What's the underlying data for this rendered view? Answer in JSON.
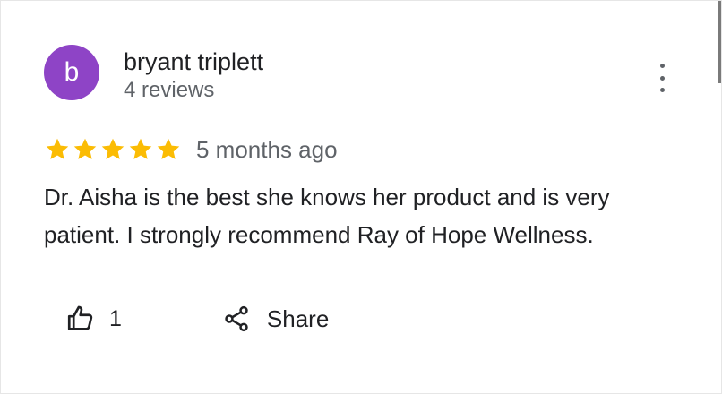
{
  "review": {
    "author": {
      "initial": "b",
      "name": "bryant triplett",
      "reviews": "4 reviews",
      "avatar_color": "#8e44c6"
    },
    "rating": 5,
    "rating_max": 5,
    "star_color": "#fbbc04",
    "date": "5 months ago",
    "text": "Dr. Aisha is the best she knows her product and is very patient. I strongly recommend Ray of Hope Wellness.",
    "more_icon": "more-vert-icon"
  },
  "actions": {
    "like_icon": "thumbs-up-icon",
    "like_count": "1",
    "share_icon": "share-icon",
    "share_label": "Share"
  }
}
